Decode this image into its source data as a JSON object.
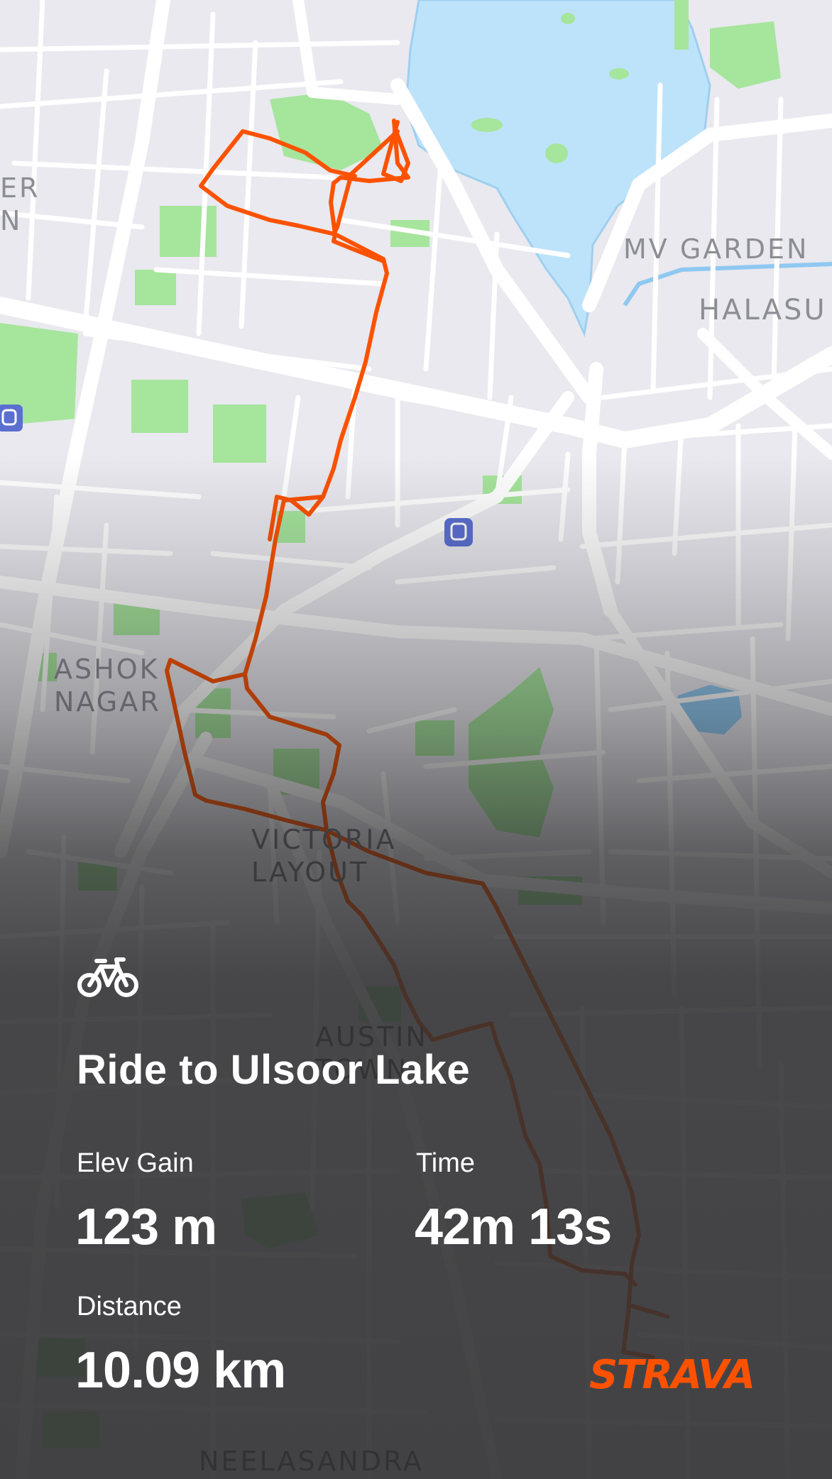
{
  "map": {
    "places": [
      {
        "id": "er",
        "text": "ER\nN"
      },
      {
        "id": "mv-garden",
        "text": "MV GARDEN"
      },
      {
        "id": "halasu",
        "text": "HALASU"
      },
      {
        "id": "ashok-nagar",
        "text": "ASHOK\nNAGAR"
      },
      {
        "id": "victoria-layout",
        "text": "VICTORIA\nLAYOUT"
      },
      {
        "id": "austin-town",
        "text": "AUSTIN\nTOWN"
      },
      {
        "id": "neelasandra",
        "text": "NEELASANDRA"
      }
    ],
    "icons": [
      "metro-icon",
      "metro-icon"
    ],
    "colors": {
      "route": "#fc5200",
      "water": "#bde3fb",
      "park": "#a6e59c",
      "road": "#ffffff",
      "land": "#e9e9ef"
    }
  },
  "activity": {
    "icon": "bicycle-icon",
    "title": "Ride to Ulsoor Lake",
    "stats": [
      {
        "label": "Elev Gain",
        "value": "123 m"
      },
      {
        "label": "Time",
        "value": "42m 13s"
      },
      {
        "label": "Distance",
        "value": "10.09 km"
      }
    ]
  },
  "brand": {
    "name": "STRAVA",
    "color": "#fc5200"
  }
}
